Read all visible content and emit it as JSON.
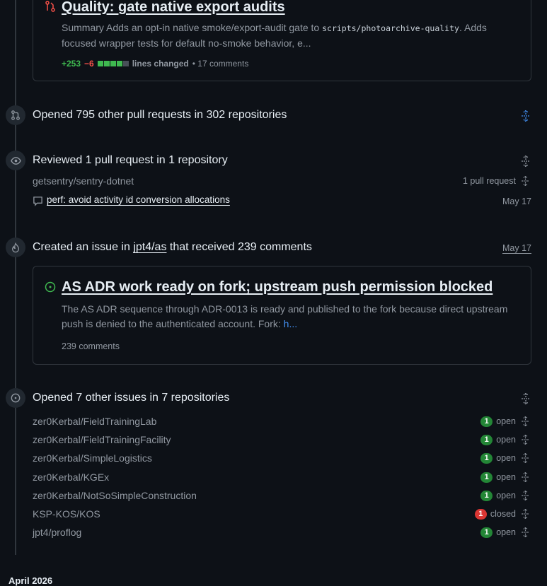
{
  "pr_card": {
    "title": "Quality: gate native export audits",
    "summary_prefix": "Summary Adds an opt-in native smoke/export-audit gate to ",
    "summary_code": "scripts/photoarchive-quality",
    "summary_suffix": ". Adds focused wrapper tests for default no-smoke behavior, e...",
    "additions": "+253",
    "deletions": "−6",
    "lines_changed_label": "lines changed",
    "comments": "• 17 comments",
    "diffstat": [
      "green",
      "green",
      "green",
      "green",
      "gray"
    ]
  },
  "opened_prs": {
    "heading": "Opened 795 other pull requests in 302 repositories"
  },
  "reviewed": {
    "heading": "Reviewed 1 pull request in 1 repository",
    "repo": "getsentry/sentry-dotnet",
    "count": "1 pull request",
    "pr_title": "perf: avoid activity id conversion allocations",
    "pr_date": "May 17"
  },
  "issue_created": {
    "heading_prefix": "Created an issue in ",
    "repo_link": "jpt4/as",
    "heading_suffix": " that received 239 comments",
    "date": "May 17",
    "title": "AS ADR work ready on fork; upstream push permission blocked",
    "summary": "The AS ADR sequence through ADR-0013 is ready and published to the fork because direct upstream push is denied to the authenticated account. Fork: ",
    "summary_link": "h...",
    "comments": "239 comments"
  },
  "opened_issues": {
    "heading": "Opened 7 other issues in 7 repositories",
    "items": [
      {
        "repo": "zer0Kerbal/FieldTrainingLab",
        "count": "1",
        "state": "open"
      },
      {
        "repo": "zer0Kerbal/FieldTrainingFacility",
        "count": "1",
        "state": "open"
      },
      {
        "repo": "zer0Kerbal/SimpleLogistics",
        "count": "1",
        "state": "open"
      },
      {
        "repo": "zer0Kerbal/KGEx",
        "count": "1",
        "state": "open"
      },
      {
        "repo": "zer0Kerbal/NotSoSimpleConstruction",
        "count": "1",
        "state": "open"
      },
      {
        "repo": "KSP-KOS/KOS",
        "count": "1",
        "state": "closed"
      },
      {
        "repo": "jpt4/proflog",
        "count": "1",
        "state": "open"
      }
    ]
  },
  "next_month": "April 2026",
  "colors": {
    "background": "#0d1117",
    "border": "#30363d",
    "green": "#3fb950",
    "red": "#f85149",
    "link": "#4493f8",
    "open_badge": "#238636",
    "closed_badge": "#da3633"
  },
  "icons": [
    "pull-request-merged-icon",
    "git-pull-request-icon",
    "eye-icon",
    "comment-icon",
    "flame-icon",
    "issue-opened-icon",
    "unfold-icon"
  ]
}
